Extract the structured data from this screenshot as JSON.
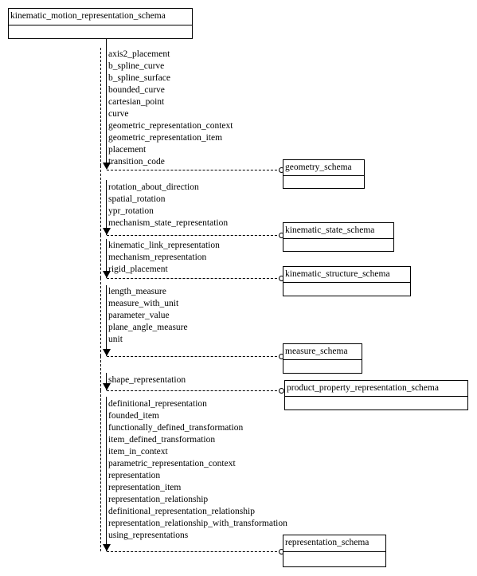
{
  "diagram": {
    "kind": "express-g-schema-interface-diagram",
    "root_schema": {
      "name": "kinematic_motion_representation_schema"
    },
    "groups": [
      {
        "id": "geometry",
        "target_schema": "geometry_schema",
        "items": [
          "axis2_placement",
          "b_spline_curve",
          "b_spline_surface",
          "bounded_curve",
          "cartesian_point",
          "curve",
          "geometric_representation_context",
          "geometric_representation_item",
          "placement",
          "transition_code"
        ]
      },
      {
        "id": "kinematic-state",
        "target_schema": "kinematic_state_schema",
        "items": [
          "rotation_about_direction",
          "spatial_rotation",
          "ypr_rotation",
          "mechanism_state_representation"
        ]
      },
      {
        "id": "kinematic-structure",
        "target_schema": "kinematic_structure_schema",
        "items": [
          "kinematic_link_representation",
          "mechanism_representation",
          "rigid_placement"
        ]
      },
      {
        "id": "measure",
        "target_schema": "measure_schema",
        "items": [
          "length_measure",
          "measure_with_unit",
          "parameter_value",
          "plane_angle_measure",
          "unit"
        ]
      },
      {
        "id": "product-property-representation",
        "target_schema": "product_property_representation_schema",
        "items": [
          "shape_representation"
        ]
      },
      {
        "id": "representation",
        "target_schema": "representation_schema",
        "items": [
          "definitional_representation",
          "founded_item",
          "functionally_defined_transformation",
          "item_defined_transformation",
          "item_in_context",
          "parametric_representation_context",
          "representation",
          "representation_item",
          "representation_relationship",
          "definitional_representation_relationship",
          "representation_relationship_with_transformation",
          "using_representations"
        ]
      }
    ],
    "colors": {
      "stroke": "#000000",
      "background": "#ffffff",
      "text": "#000000"
    }
  }
}
